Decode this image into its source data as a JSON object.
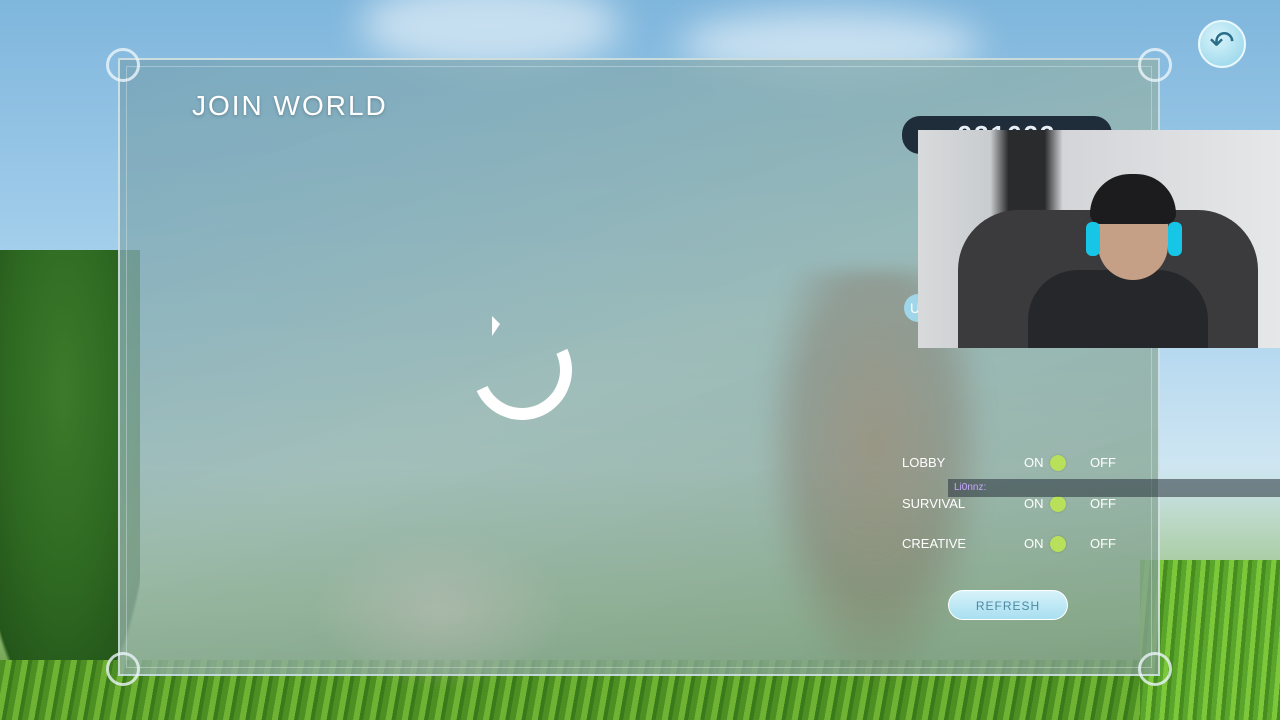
{
  "screen": {
    "title": "JOIN WORLD",
    "world_code": "931623"
  },
  "filters": [
    {
      "label": "LOBBY",
      "on": "ON",
      "off": "OFF",
      "state": "on"
    },
    {
      "label": "SURVIVAL",
      "on": "ON",
      "off": "OFF",
      "state": "on"
    },
    {
      "label": "CREATIVE",
      "on": "ON",
      "off": "OFF",
      "state": "on"
    }
  ],
  "refresh_label": "REFRESH",
  "partial_tag": "U",
  "chat": {
    "username": "Li0nnz:"
  },
  "icons": {
    "back": "back-arrow-icon",
    "spinner": "loading-spinner-icon",
    "cursor": "mouse-cursor-icon"
  },
  "colors": {
    "accent": "#9fd6ea",
    "toggle_on": "#b8e05a",
    "code_bg": "#1f2c3a"
  }
}
